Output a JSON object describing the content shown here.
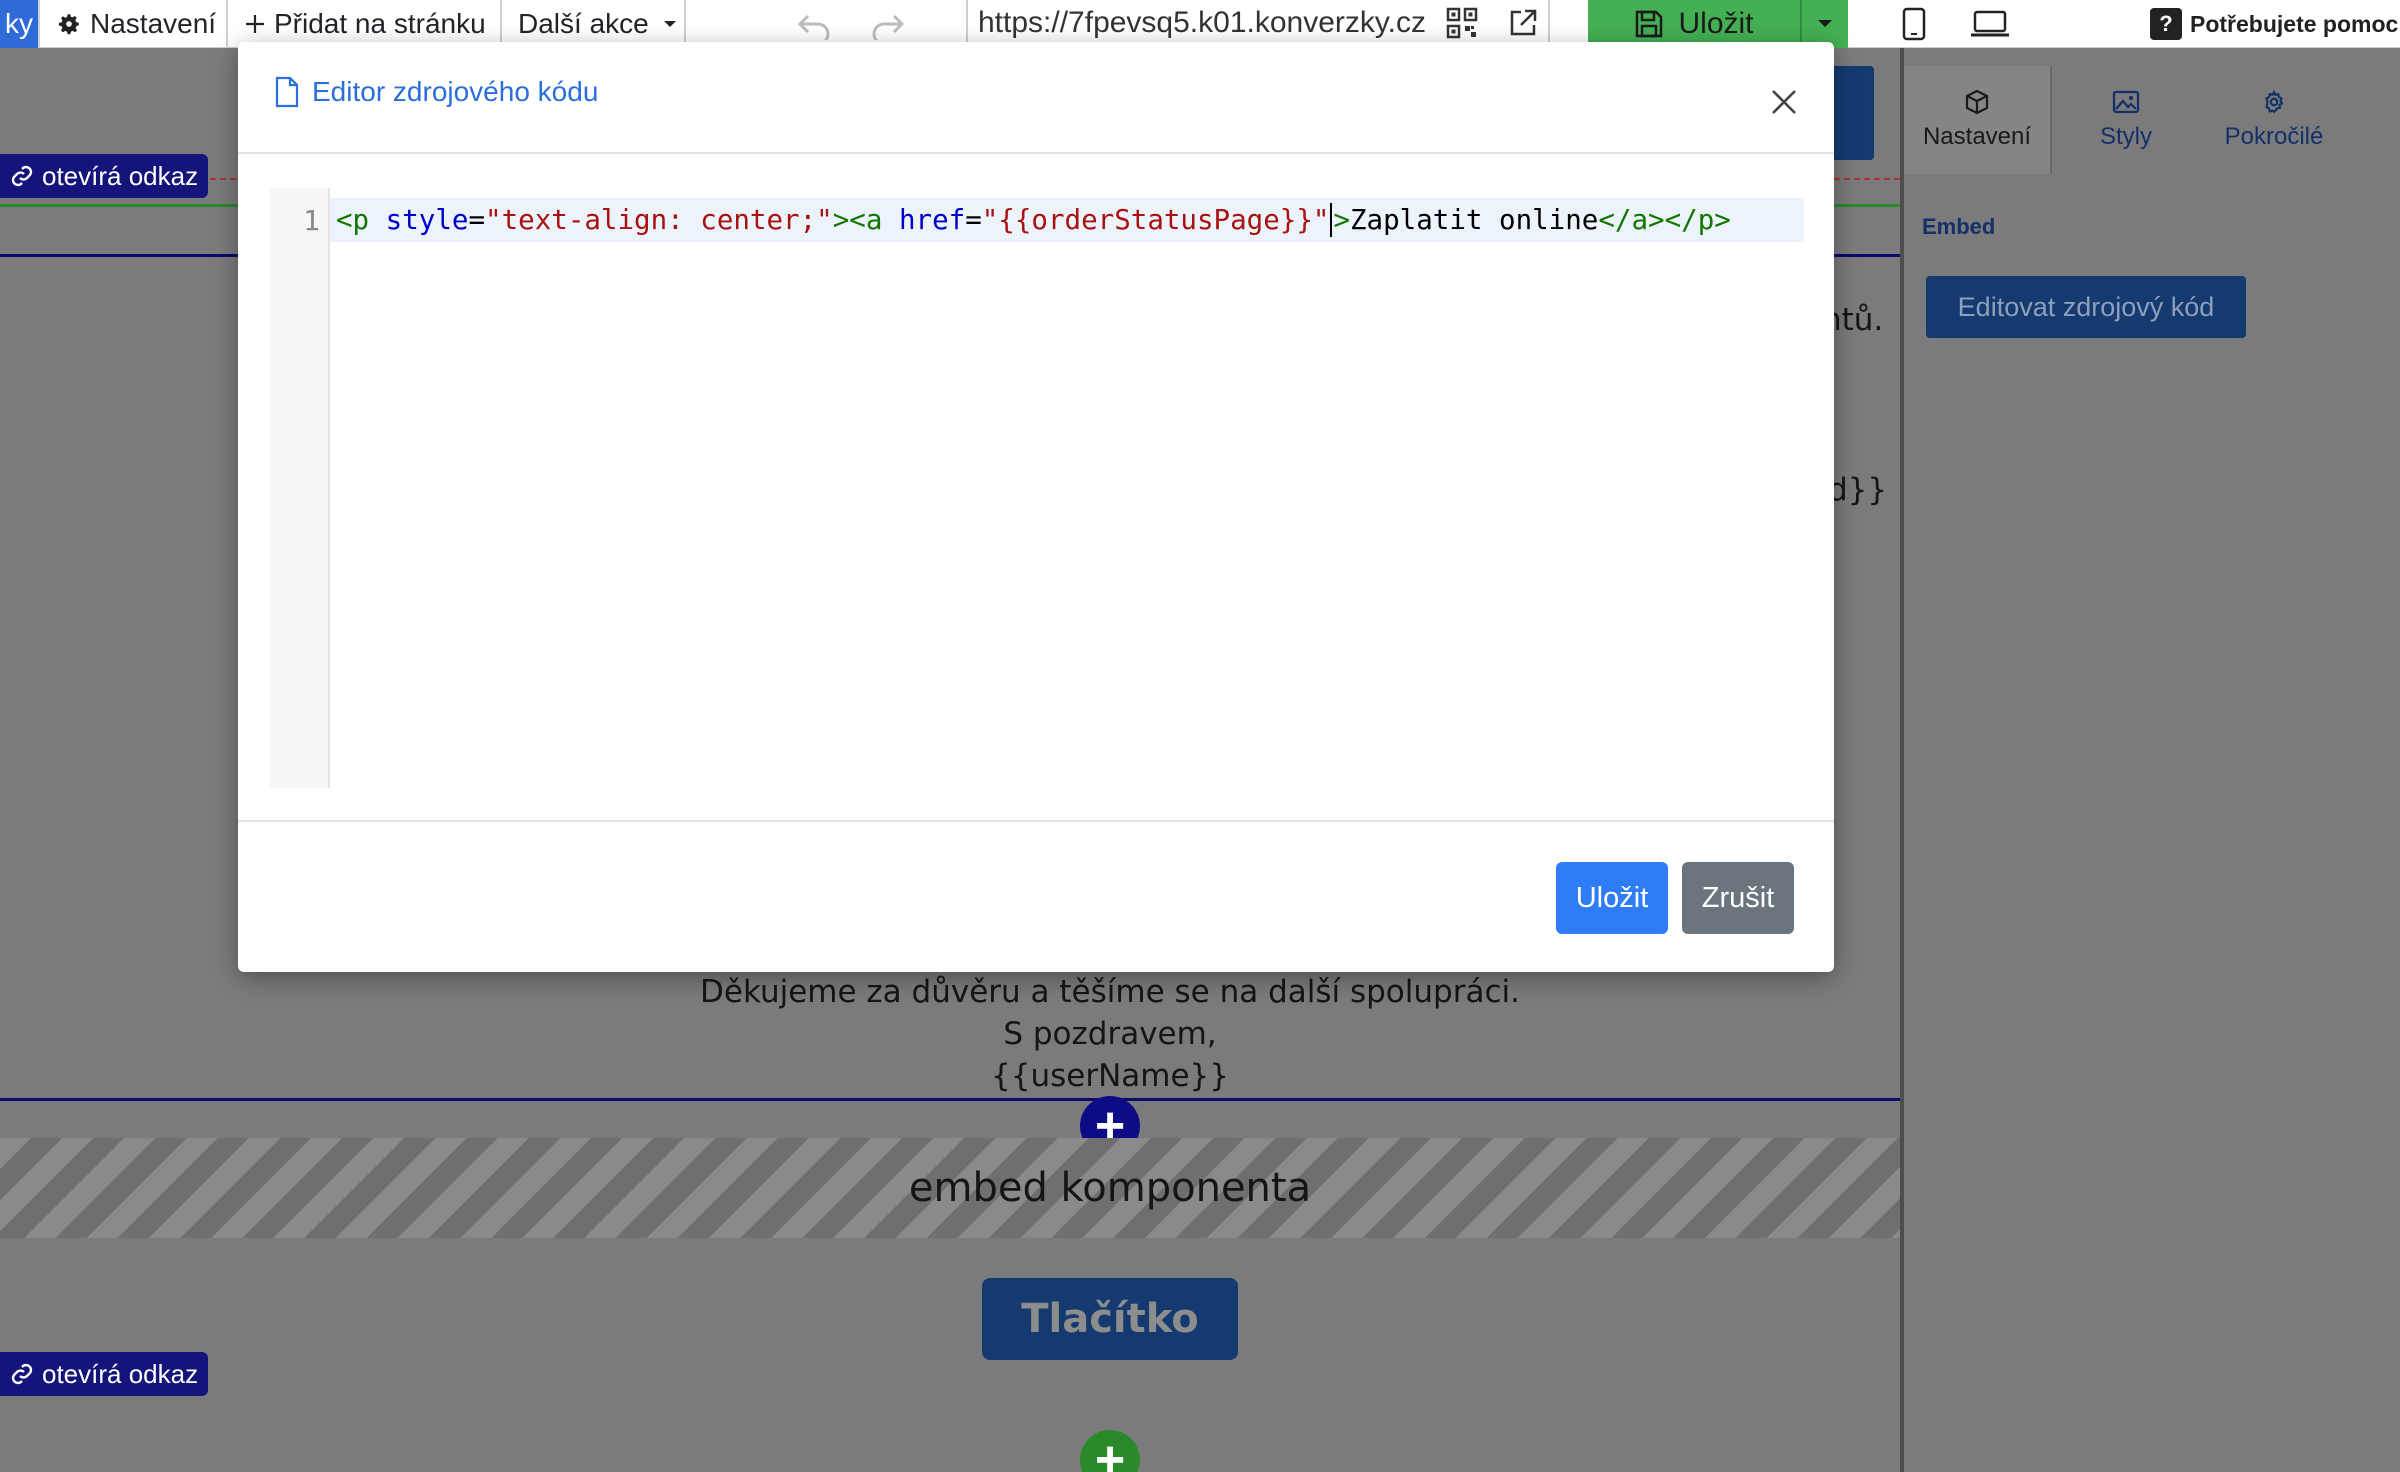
{
  "toolbar": {
    "cut_label": "ky",
    "settings_label": "Nastavení",
    "add_label": "Přidat na stránku",
    "more_label": "Další akce",
    "url": "https://7fpevsq5.k01.konverzky.cz",
    "save_label": "Uložit",
    "help_label": "Potřebujete pomoc"
  },
  "canvas": {
    "link_badge_label": "otevírá odkaz",
    "partial_text_1": "ntů.",
    "partial_text_2": "d}}",
    "thanks_text": "Děkujeme za důvěru a těšíme se na další spolupráci.",
    "regards_text": "S pozdravem,",
    "username_text": "{{userName}}",
    "embed_label": "embed komponenta",
    "button_label": "Tlačítko"
  },
  "right_panel": {
    "tabs": [
      {
        "label": "Nastavení",
        "icon": "cube-icon"
      },
      {
        "label": "Styly",
        "icon": "image-icon"
      },
      {
        "label": "Pokročilé",
        "icon": "gear-icon"
      }
    ],
    "section_label": "Embed",
    "edit_button_label": "Editovat zdrojový kód"
  },
  "modal": {
    "title": "Editor zdrojového kódu",
    "line_number": "1",
    "code": {
      "t1": "<p ",
      "a1": "style",
      "eq1": "=",
      "s1": "\"text-align: center;\"",
      "t2": "><a ",
      "a2": "href",
      "eq2": "=",
      "s2": "\"{{orderStatusPage}}\"",
      "t3": ">",
      "text": "Zaplatit online",
      "t4": "</a></p>"
    },
    "save_label": "Uložit",
    "cancel_label": "Zrušit"
  },
  "colors": {
    "accent": "#2f7df6",
    "secondary": "#6c757d",
    "save_green": "#44b054"
  }
}
